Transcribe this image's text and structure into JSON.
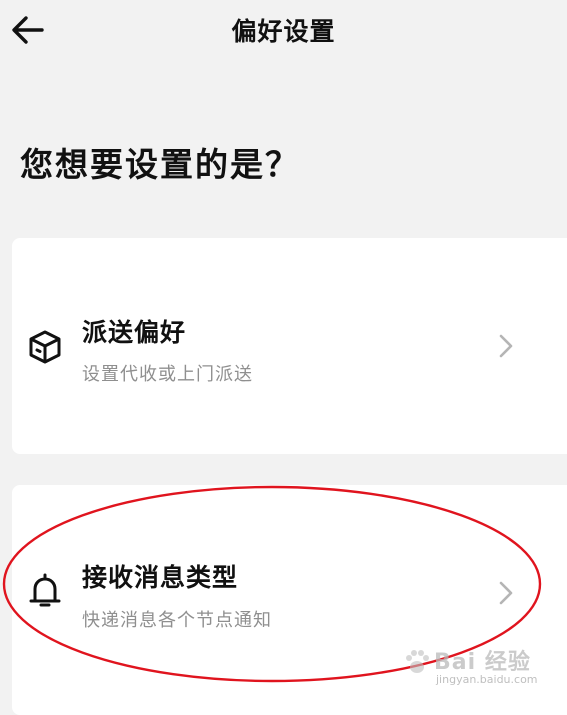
{
  "header": {
    "title": "偏好设置",
    "back_icon": "arrow-left-icon"
  },
  "question": "您想要设置的是？",
  "cards": [
    {
      "title": "派送偏好",
      "subtitle": "设置代收或上门派送",
      "icon": "package-box-icon"
    },
    {
      "title": "接收消息类型",
      "subtitle": "快递消息各个节点通知",
      "icon": "bell-icon"
    }
  ],
  "watermark": {
    "main": "Bai 经验",
    "sub": "jingyan.baidu.com"
  },
  "colors": {
    "background": "#f2f2f2",
    "card": "#ffffff",
    "subtitle": "#8f8f8f",
    "highlight": "#e0141e"
  }
}
